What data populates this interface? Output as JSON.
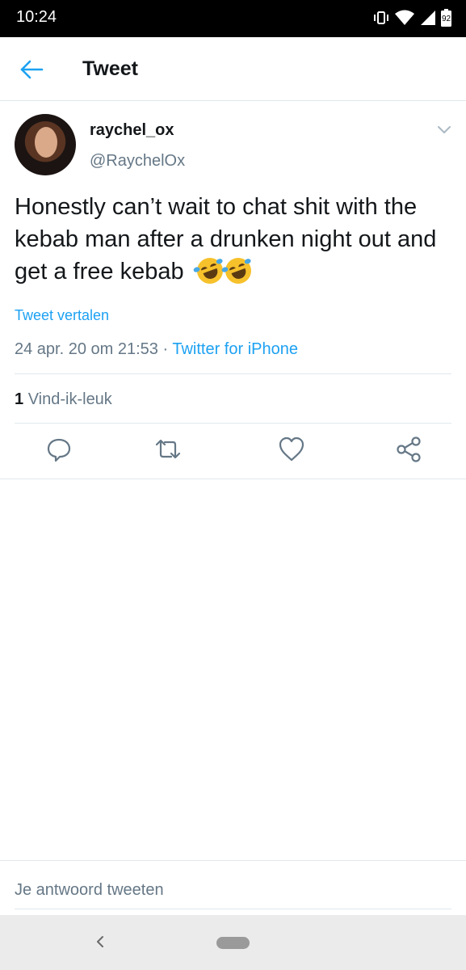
{
  "status_bar": {
    "time": "10:24",
    "battery": "92"
  },
  "nav": {
    "title": "Tweet"
  },
  "tweet": {
    "display_name": "raychel_ox",
    "handle": "@RaychelOx",
    "text": "Honestly can’t wait to chat shit with the kebab man after a drunken night out and get a free kebab",
    "translate_label": "Tweet vertalen",
    "timestamp": "24 apr. 20 om 21:53",
    "separator": " · ",
    "source": "Twitter for iPhone",
    "likes_count": "1",
    "likes_label": "Vind-ik-leuk"
  },
  "icons": {
    "status": [
      "vibrate-icon",
      "wifi-icon",
      "signal-icon",
      "battery-icon"
    ],
    "actions": [
      "reply-icon",
      "retweet-icon",
      "like-icon",
      "share-icon"
    ]
  },
  "colors": {
    "accent": "#1da1f2",
    "muted": "#657786",
    "text": "#14171a",
    "divider": "#e1e8ed"
  },
  "reply": {
    "placeholder": "Je antwoord tweeten"
  }
}
